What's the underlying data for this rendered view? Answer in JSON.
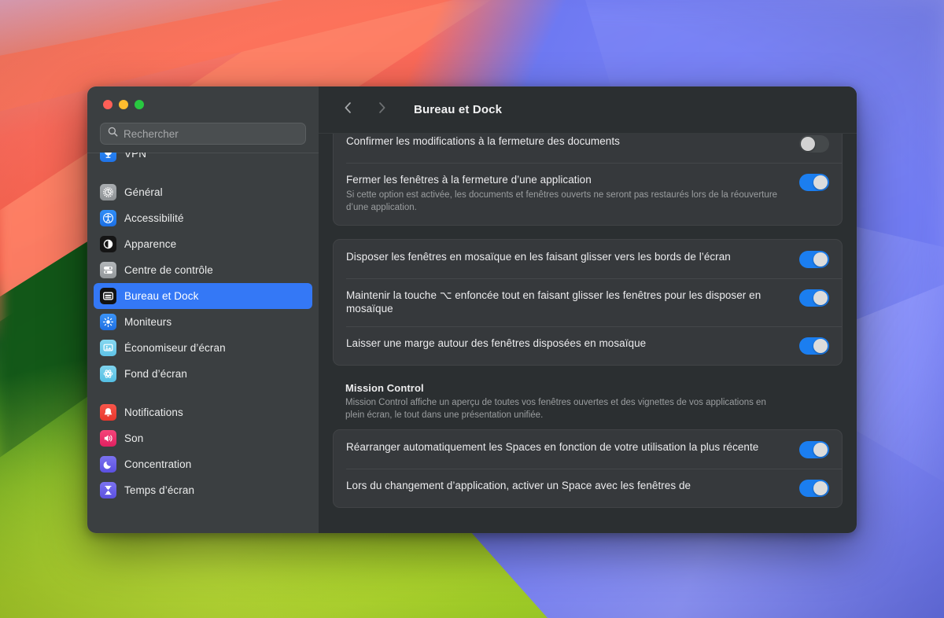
{
  "window": {
    "traffic_lights": [
      {
        "name": "close",
        "color": "#ff5f57"
      },
      {
        "name": "minimize",
        "color": "#febc2e"
      },
      {
        "name": "zoom",
        "color": "#28c840"
      }
    ]
  },
  "search": {
    "placeholder": "Rechercher",
    "value": ""
  },
  "sidebar": {
    "partial_top_item": {
      "label": "VPN"
    },
    "groups": [
      {
        "items": [
          {
            "label": "Général",
            "icon": "gear-icon",
            "selected": false
          },
          {
            "label": "Accessibilité",
            "icon": "accessibility-icon",
            "selected": false
          },
          {
            "label": "Apparence",
            "icon": "appearance-icon",
            "selected": false
          },
          {
            "label": "Centre de contrôle",
            "icon": "control-center-icon",
            "selected": false
          },
          {
            "label": "Bureau et Dock",
            "icon": "desktop-dock-icon",
            "selected": true
          },
          {
            "label": "Moniteurs",
            "icon": "displays-icon",
            "selected": false
          },
          {
            "label": "Économiseur d’écran",
            "icon": "screensaver-icon",
            "selected": false
          },
          {
            "label": "Fond d’écran",
            "icon": "wallpaper-icon",
            "selected": false
          }
        ]
      },
      {
        "items": [
          {
            "label": "Notifications",
            "icon": "notifications-icon",
            "selected": false
          },
          {
            "label": "Son",
            "icon": "sound-icon",
            "selected": false
          },
          {
            "label": "Concentration",
            "icon": "focus-icon",
            "selected": false
          },
          {
            "label": "Temps d’écran",
            "icon": "screen-time-icon",
            "selected": false
          }
        ]
      }
    ]
  },
  "toolbar": {
    "back_icon": "chevron-left-icon",
    "forward_icon": "chevron-right-icon",
    "title": "Bureau et Dock"
  },
  "content": {
    "card_windows": {
      "rows": [
        {
          "title": "Confirmer les modifications à la fermeture des documents",
          "sub": "",
          "toggle": "off"
        },
        {
          "title": "Fermer les fenêtres à la fermeture d’une application",
          "sub": "Si cette option est activée, les documents et fenêtres ouverts ne seront pas restaurés lors de la réouverture d’une application.",
          "toggle": "on"
        }
      ]
    },
    "card_tiling": {
      "rows": [
        {
          "title": "Disposer les fenêtres en mosaïque en les faisant glisser vers les bords de l’écran",
          "sub": "",
          "toggle": "on"
        },
        {
          "title": "Maintenir la touche ⌥ enfoncée tout en faisant glisser les fenêtres pour les disposer en mosaïque",
          "sub": "",
          "toggle": "on"
        },
        {
          "title": "Laisser une marge autour des fenêtres disposées en mosaïque",
          "sub": "",
          "toggle": "on"
        }
      ]
    },
    "section_mission_control": {
      "title": "Mission Control",
      "description": "Mission Control affiche un aperçu de toutes vos fenêtres ouvertes et des vignettes de vos applications en plein écran, le tout dans une présentation unifiée."
    },
    "card_mission_control": {
      "rows": [
        {
          "title": "Réarranger automatiquement les Spaces en fonction de votre utilisation la plus récente",
          "sub": "",
          "toggle": "on"
        },
        {
          "title": "Lors du changement d’application, activer un Space avec les fenêtres de",
          "sub": "",
          "toggle": "on"
        }
      ]
    }
  },
  "colors": {
    "accent": "#3478f6",
    "toggle_on": "#1b7ef0",
    "toggle_off": "#45494b",
    "sidebar_bg": "#3b3f41",
    "detail_bg": "#2b2f31",
    "card_bg": "#36393c"
  }
}
